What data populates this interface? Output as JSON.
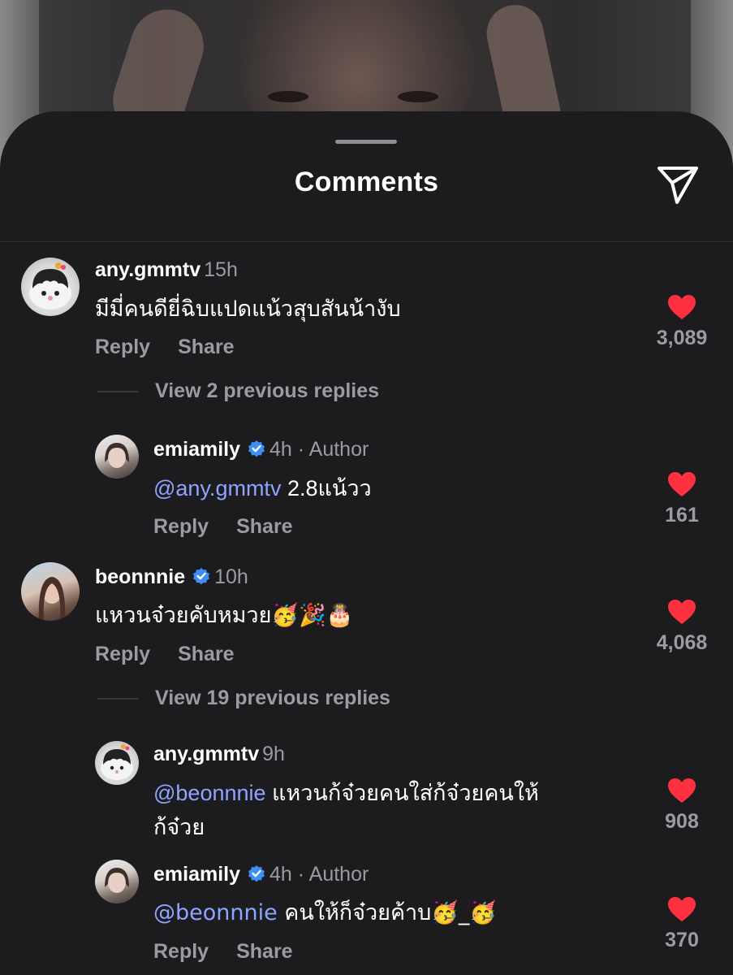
{
  "sheet": {
    "title": "Comments",
    "send_icon": "paper-plane-icon"
  },
  "colors": {
    "background": "#1c1c1e",
    "like_heart": "#ff3040",
    "mention": "#8fa4ff",
    "verified": "#3d8ef5",
    "secondary_text": "#9b9ba0"
  },
  "labels": {
    "reply": "Reply",
    "share": "Share"
  },
  "comments": [
    {
      "username": "any.gmmtv",
      "time": "15h",
      "text": "มีมี่คนดียี่ฉิบแปดแน้วสุบสันน้างับ",
      "likes": "3,089",
      "view_replies": "View 2 previous replies",
      "reply": {
        "username": "emiamily",
        "meta": "4h · Author",
        "mention": "@any.gmmtv",
        "text": " 2.8แน้วว",
        "likes": "161"
      }
    },
    {
      "username": "beonnnie",
      "time": "10h",
      "text": "แหวนจ๋วยคับหมวย🥳🎉🎂",
      "likes": "4,068",
      "view_replies": "View 19 previous replies",
      "replies": [
        {
          "username": "any.gmmtv",
          "meta": "9h",
          "mention": "@beonnnie",
          "text_line1": " แหวนก้จ๋วยคนใส่ก้จ๋วยคนให้",
          "text_line2": "ก้จ๋วย",
          "likes": "908"
        },
        {
          "username": "emiamily",
          "meta": "4h · Author",
          "mention": "@beonnnie",
          "text": " คนให้ก็จ๋วยค้าบ🥳_🥳",
          "likes": "370"
        }
      ]
    }
  ]
}
